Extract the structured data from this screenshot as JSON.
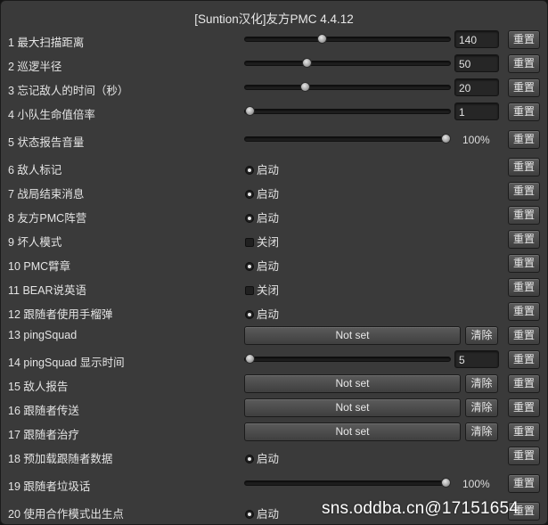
{
  "window": {
    "title": "[Suntion汉化]友方PMC 4.4.12"
  },
  "rows": [
    {
      "label": "1 最大扫描距离",
      "value": "140",
      "slider_fraction": 0.37,
      "reset": "重置"
    },
    {
      "label": "2 巡逻半径",
      "value": "50",
      "slider_fraction": 0.29,
      "reset": "重置"
    },
    {
      "label": "3 忘记敌人的时间（秒）",
      "value": "20",
      "slider_fraction": 0.28,
      "reset": "重置"
    },
    {
      "label": "4 小队生命值倍率",
      "value": "1",
      "slider_fraction": 0.0,
      "reset": "重置"
    },
    {
      "label": "5 状态报告音量",
      "percent": "100%",
      "slider_fraction": 1.0,
      "reset": "重置"
    },
    {
      "label": "6 敌人标记",
      "state": "启动",
      "reset": "重置"
    },
    {
      "label": "7 战局结束消息",
      "state": "启动",
      "reset": "重置"
    },
    {
      "label": "8 友方PMC阵营",
      "state": "启动",
      "reset": "重置"
    },
    {
      "label": "9 坏人模式",
      "state": "关闭",
      "reset": "重置"
    },
    {
      "label": "10 PMC臂章",
      "state": "启动",
      "reset": "重置"
    },
    {
      "label": "11 BEAR说英语",
      "state": "关闭",
      "reset": "重置"
    },
    {
      "label": "12 跟随者使用手榴弹",
      "state": "启动",
      "reset": "重置"
    },
    {
      "label": "13  pingSquad",
      "keybind": "Not set",
      "clear": "清除",
      "reset": "重置"
    },
    {
      "label": "14  pingSquad 显示时间",
      "value": "5",
      "slider_fraction": 0.0,
      "reset": "重置"
    },
    {
      "label": "15 敌人报告",
      "keybind": "Not set",
      "clear": "清除",
      "reset": "重置"
    },
    {
      "label": "16 跟随者传送",
      "keybind": "Not set",
      "clear": "清除",
      "reset": "重置"
    },
    {
      "label": "17 跟随者治疗",
      "keybind": "Not set",
      "clear": "清除",
      "reset": "重置"
    },
    {
      "label": "18 预加载跟随者数据",
      "state": "启动",
      "reset": "重置"
    },
    {
      "label": "19 跟随者垃圾话",
      "percent": "100%",
      "slider_fraction": 1.0,
      "reset": "重置"
    },
    {
      "label": "20 使用合作模式出生点",
      "state": "启动",
      "reset": "重置"
    }
  ],
  "watermark": "sns.oddba.cn@17151654"
}
